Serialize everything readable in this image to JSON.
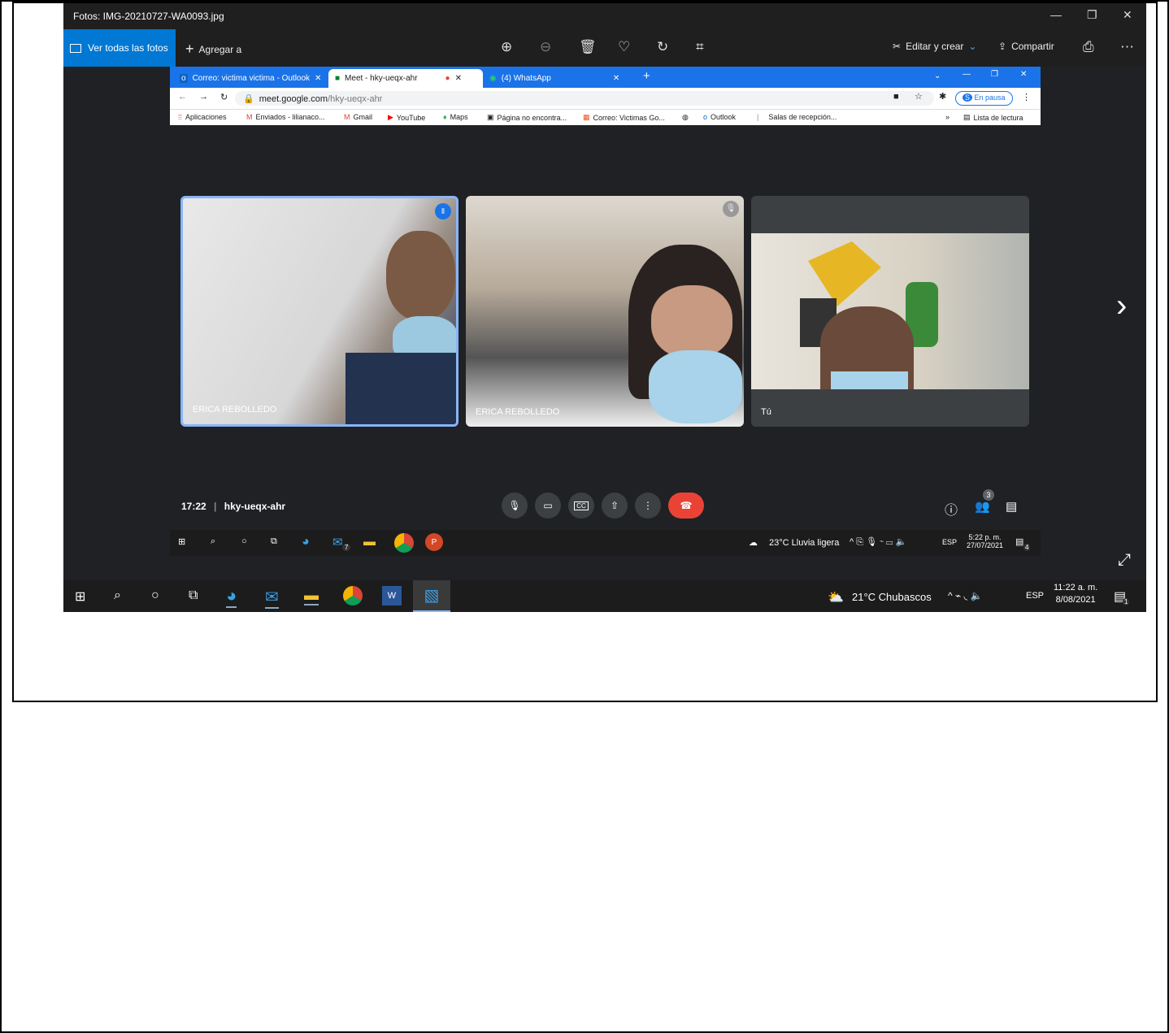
{
  "photos": {
    "title": "Fotos: IMG-20210727-WA0093.jpg",
    "view_all": "Ver todas las fotos",
    "add_to": "Agregar a",
    "edit_create": "Editar y crear",
    "share": "Compartir"
  },
  "browser": {
    "tabs": [
      {
        "label": "Correo: victima victima - Outlook"
      },
      {
        "label": "Meet - hky-ueqx-ahr"
      },
      {
        "label": "(4) WhatsApp"
      }
    ],
    "url_host": "meet.google.com",
    "url_path": "/hky-ueqx-ahr",
    "profile_status": "En pausa",
    "bookmarks": [
      "Aplicaciones",
      "Enviados - lilianaco...",
      "Gmail",
      "YouTube",
      "Maps",
      "Página no encontra...",
      "Correo: Victimas Go...",
      "Outlook",
      "Salas de recepción..."
    ],
    "overflow": "»",
    "reading_list": "Lista de lectura"
  },
  "meet": {
    "participants": [
      {
        "name": "ERICA REBOLLEDO"
      },
      {
        "name": "ERICA REBOLLEDO"
      },
      {
        "name": "Tú"
      }
    ],
    "time": "17:22",
    "code": "hky-ueqx-ahr",
    "people_count": "3"
  },
  "inner_taskbar": {
    "weather": "23°C  Lluvia ligera",
    "lang": "ESP",
    "time": "5:22 p. m.",
    "date": "27/07/2021",
    "mail_badge": "7",
    "notif": "4"
  },
  "outer_taskbar": {
    "weather": "21°C  Chubascos",
    "lang": "ESP",
    "time": "11:22 a. m.",
    "date": "8/08/2021",
    "notif": "1"
  }
}
